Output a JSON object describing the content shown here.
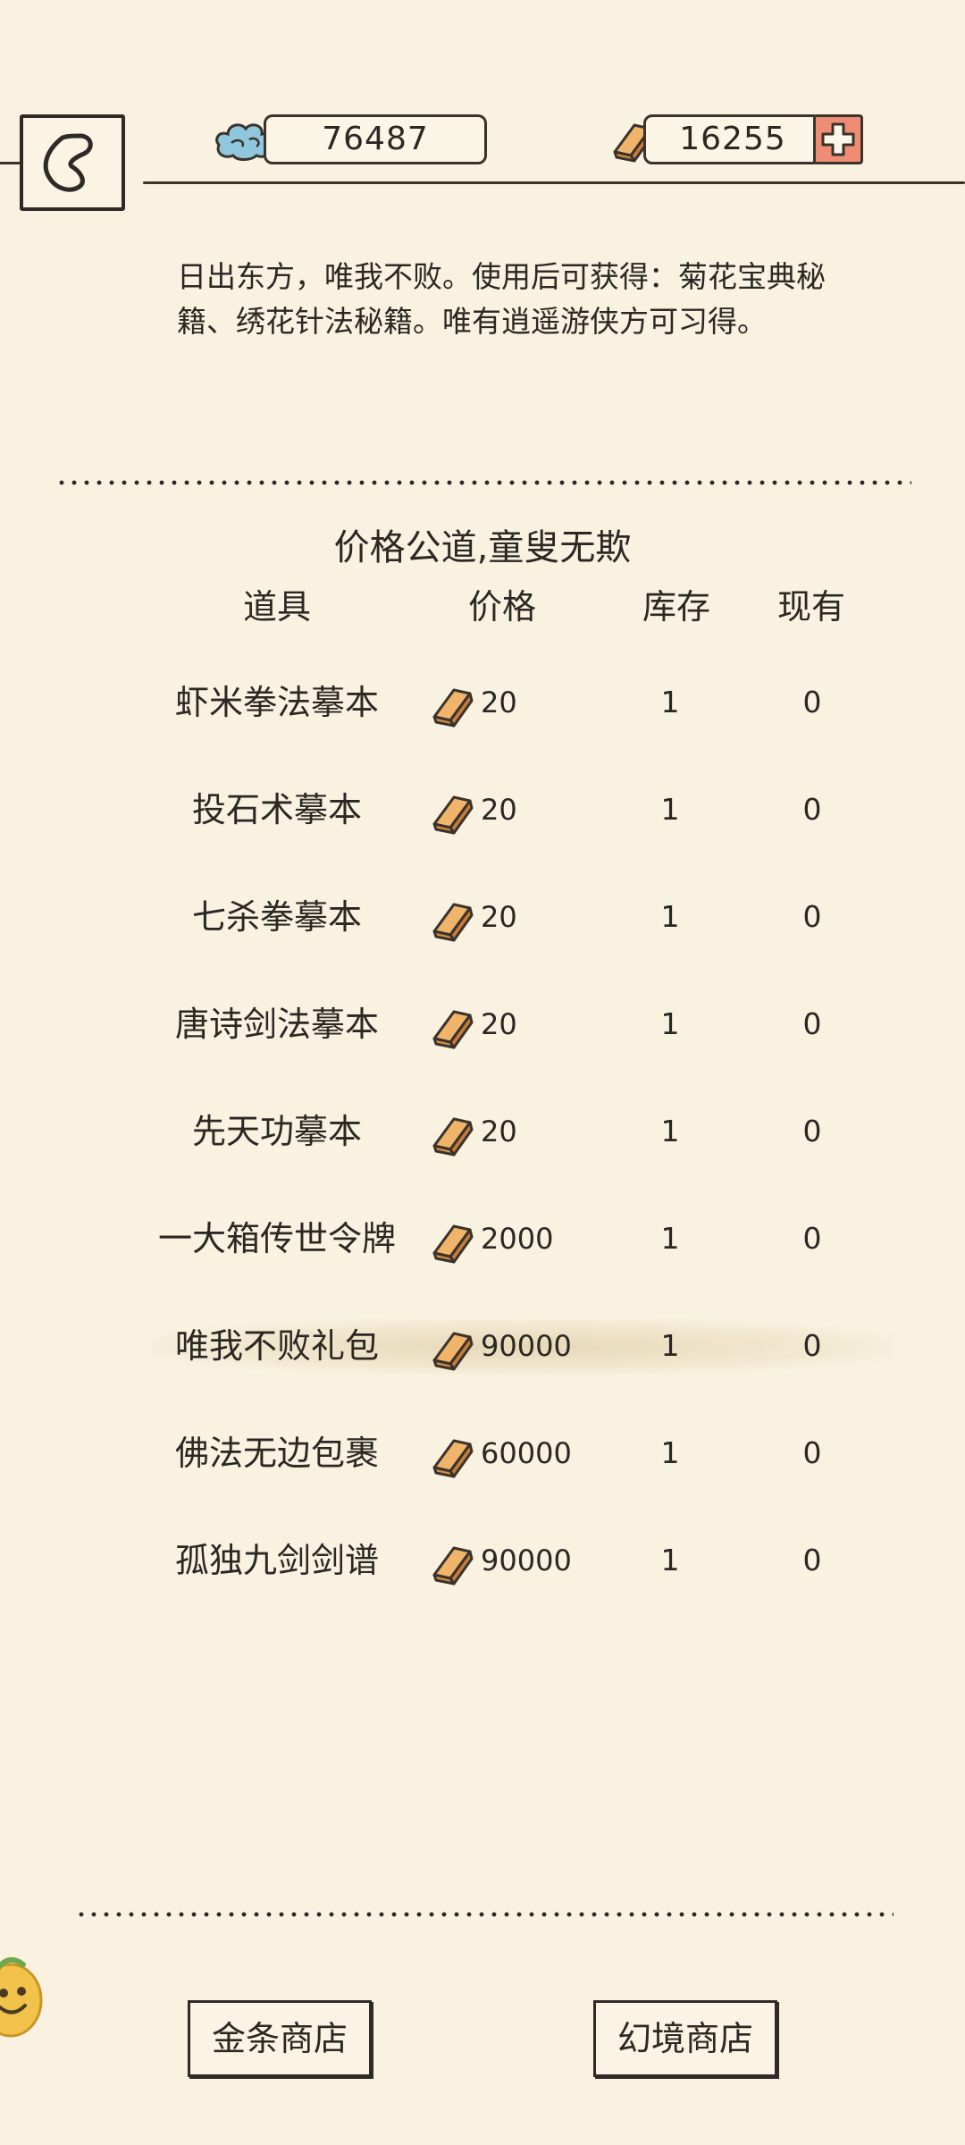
{
  "currency": {
    "silver": "76487",
    "gold": "16255"
  },
  "description": "日出东方，唯我不败。使用后可获得：菊花宝典秘籍、绣花针法秘籍。唯有逍遥游侠方可习得。",
  "shop": {
    "title": "价格公道,童叟无欺",
    "headers": {
      "item": "道具",
      "price": "价格",
      "stock": "库存",
      "owned": "现有"
    },
    "items": [
      {
        "name": "虾米拳法摹本",
        "price": "20",
        "stock": "1",
        "owned": "0"
      },
      {
        "name": "投石术摹本",
        "price": "20",
        "stock": "1",
        "owned": "0"
      },
      {
        "name": "七杀拳摹本",
        "price": "20",
        "stock": "1",
        "owned": "0"
      },
      {
        "name": "唐诗剑法摹本",
        "price": "20",
        "stock": "1",
        "owned": "0"
      },
      {
        "name": "先天功摹本",
        "price": "20",
        "stock": "1",
        "owned": "0"
      },
      {
        "name": "一大箱传世令牌",
        "price": "2000",
        "stock": "1",
        "owned": "0"
      },
      {
        "name": "唯我不败礼包",
        "price": "90000",
        "stock": "1",
        "owned": "0"
      },
      {
        "name": "佛法无边包裹",
        "price": "60000",
        "stock": "1",
        "owned": "0"
      },
      {
        "name": "孤独九剑剑谱",
        "price": "90000",
        "stock": "1",
        "owned": "0"
      }
    ],
    "selected_index": 6
  },
  "buttons": {
    "gold_shop": "金条商店",
    "illusion_shop": "幻境商店"
  },
  "icons": {
    "back": "back-arrow-icon",
    "silver": "cloud-silver-icon",
    "gold": "gold-bar-icon",
    "add": "plus-icon",
    "mascot": "mascot-icon"
  },
  "colors": {
    "background": "#f9f2e1",
    "gold_bar": "#e8a35a",
    "plus_button": "#ee8d74",
    "highlight": "#e0cfaa"
  }
}
